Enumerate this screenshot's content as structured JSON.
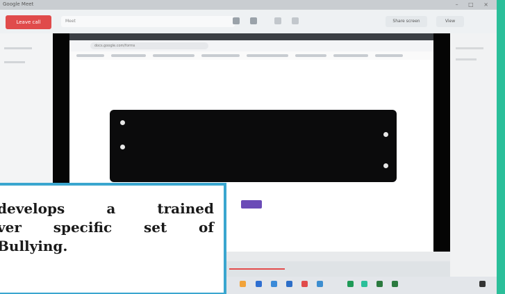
{
  "window": {
    "title": "Google Meet",
    "controls": "– □ ×"
  },
  "meet_bar": {
    "leave_label": "Leave call",
    "field_text": "Meet",
    "share_label": "Share screen",
    "view_label": "View"
  },
  "inner_browser": {
    "url": "docs.google.com/forms"
  },
  "dialog": {
    "option_1_label": "",
    "option_2_label": "",
    "body_text": ""
  },
  "purple_button_label": "",
  "caption": {
    "line1_words": [
      "develops",
      "a",
      "trained"
    ],
    "line2_words": [
      "ver",
      "specific",
      "set",
      "of"
    ],
    "line3": "Bullying."
  },
  "colors": {
    "caption_border": "#3aa6cf",
    "leave_button": "#e04b4b",
    "purple_button": "#6b4bb7",
    "background_accent": "#2bbf9a"
  }
}
